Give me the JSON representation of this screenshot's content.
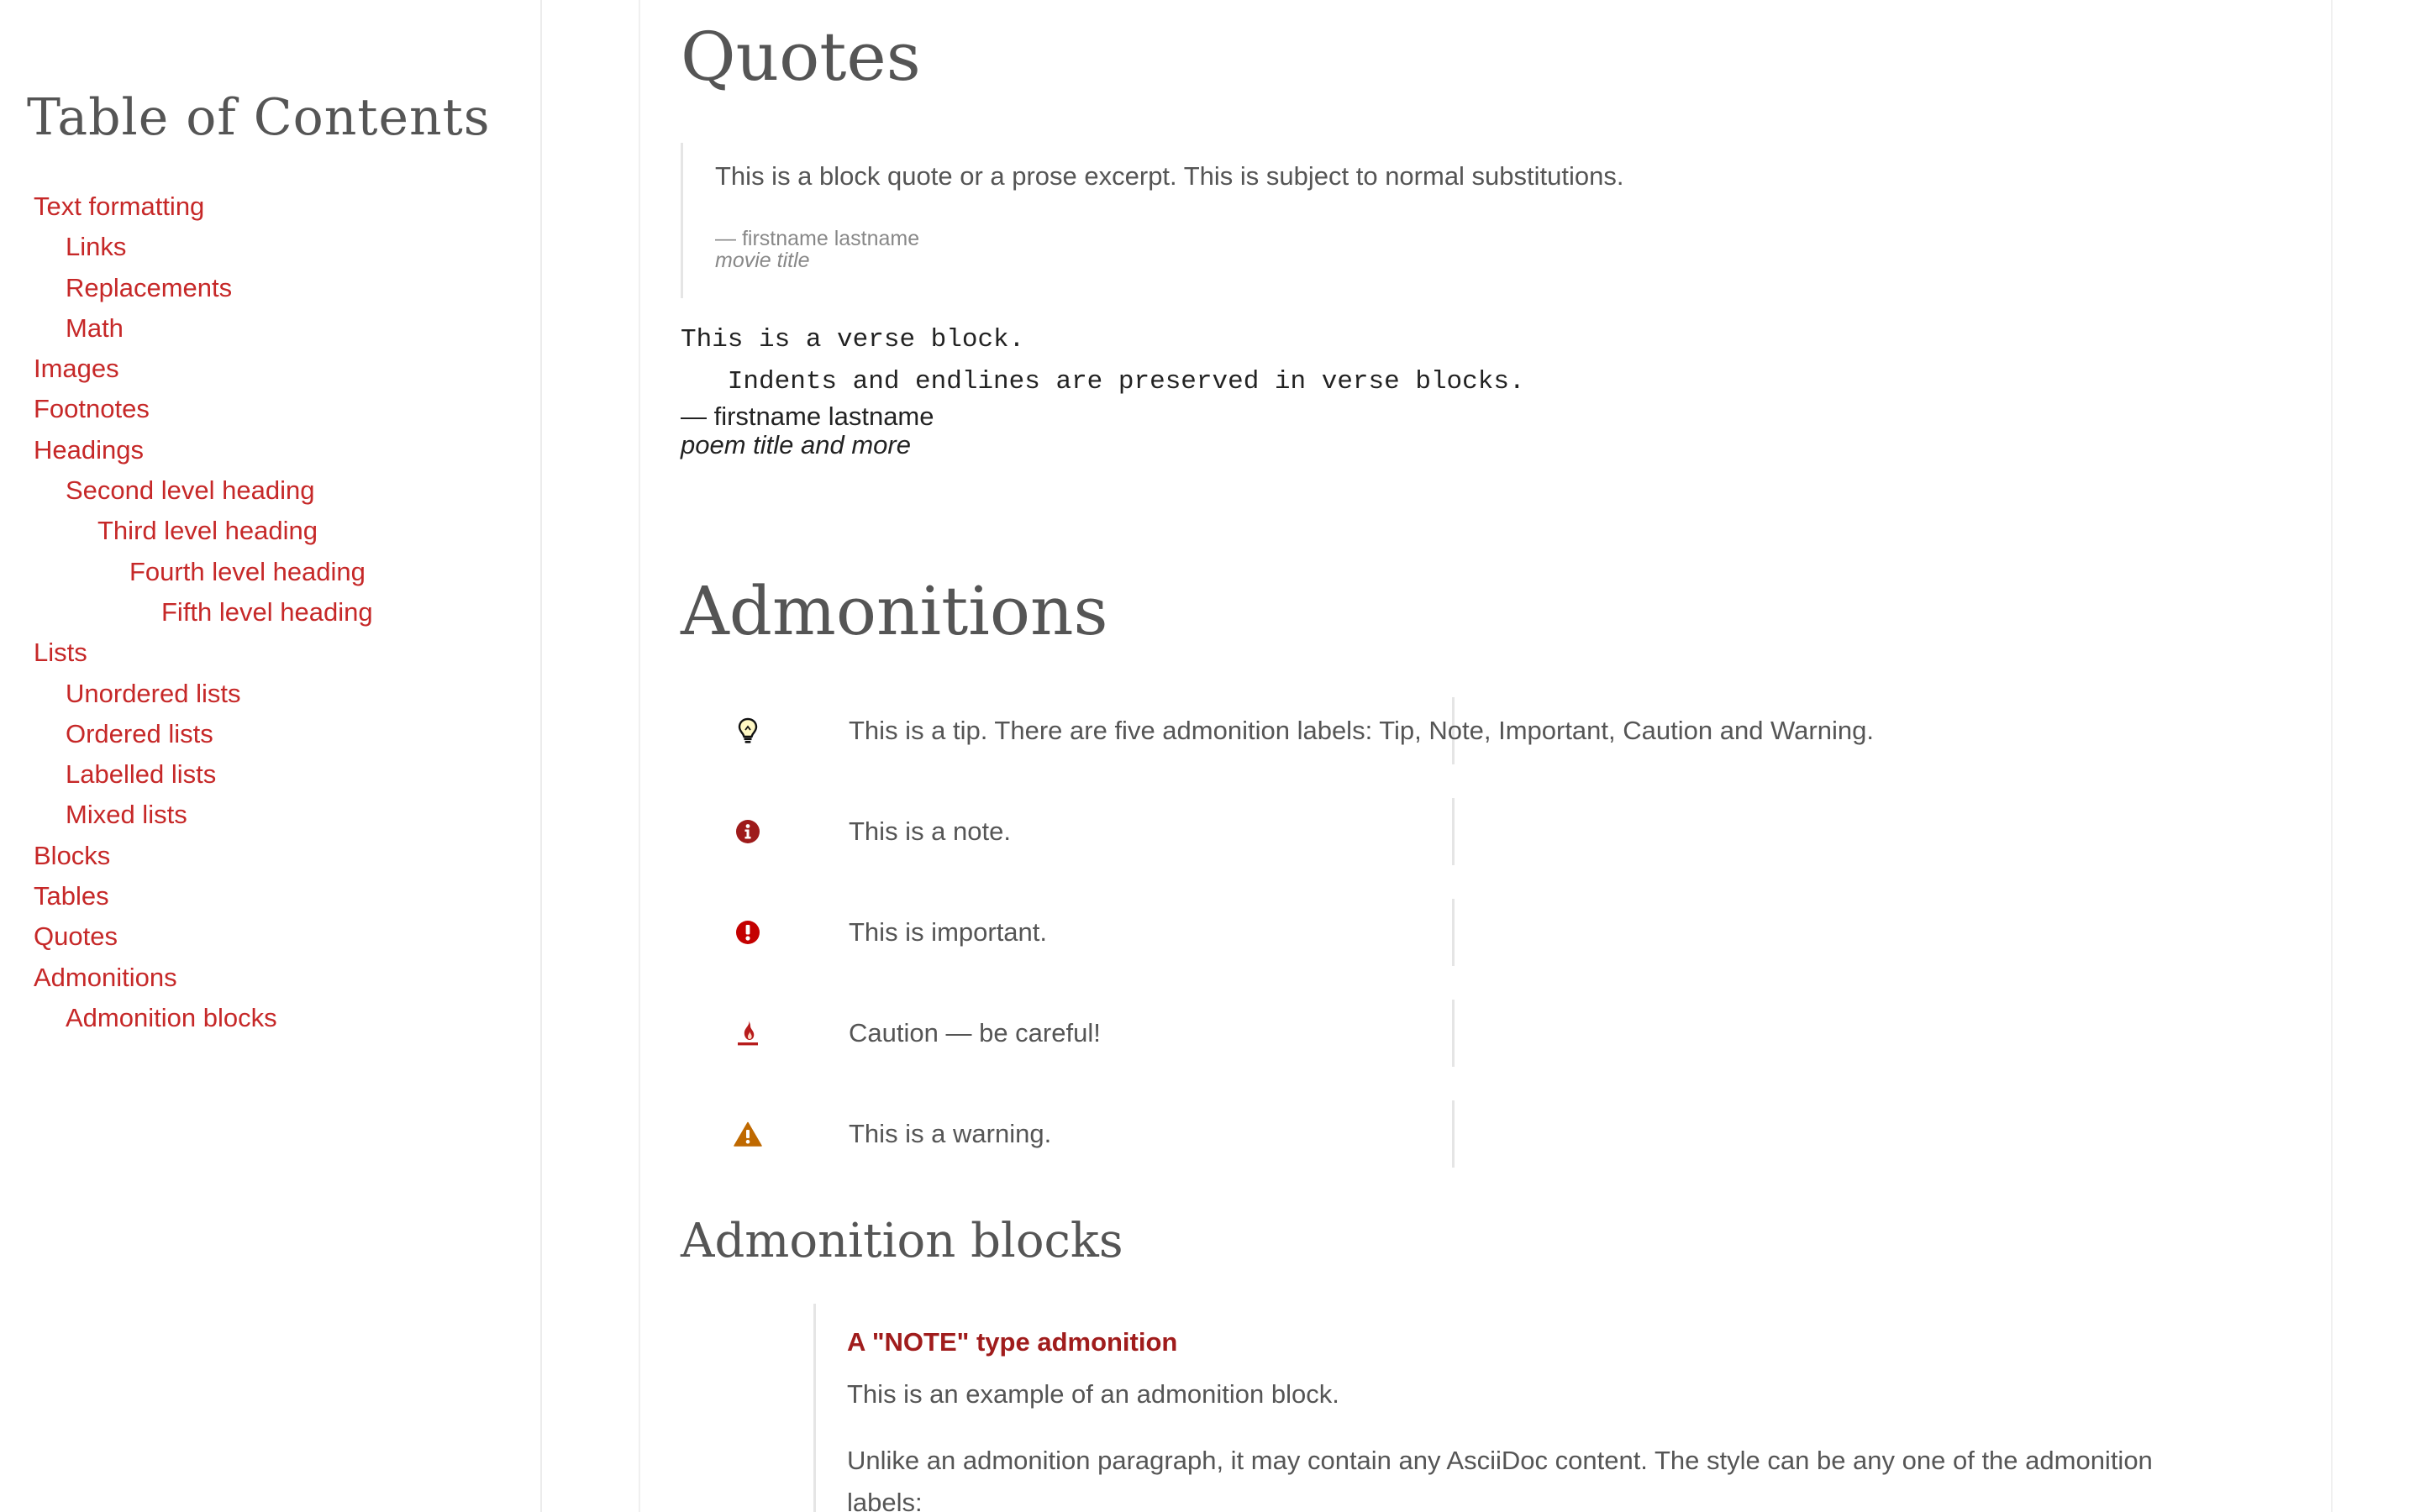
{
  "toc": {
    "title": "Table of Contents",
    "items": [
      {
        "label": "Text formatting"
      },
      {
        "label": "Links"
      },
      {
        "label": "Replacements"
      },
      {
        "label": "Math"
      },
      {
        "label": "Images"
      },
      {
        "label": "Footnotes"
      },
      {
        "label": "Headings"
      },
      {
        "label": "Second level heading"
      },
      {
        "label": "Third level heading"
      },
      {
        "label": "Fourth level heading"
      },
      {
        "label": "Fifth level heading"
      },
      {
        "label": "Lists"
      },
      {
        "label": "Unordered lists"
      },
      {
        "label": "Ordered lists"
      },
      {
        "label": "Labelled lists"
      },
      {
        "label": "Mixed lists"
      },
      {
        "label": "Blocks"
      },
      {
        "label": "Tables"
      },
      {
        "label": "Quotes"
      },
      {
        "label": "Admonitions"
      },
      {
        "label": "Admonition blocks"
      }
    ]
  },
  "quotes": {
    "title": "Quotes",
    "blockquote": {
      "text": "This is a block quote or a prose excerpt. This is subject to normal substitutions.",
      "author": "— firstname lastname",
      "cite": "movie title"
    },
    "verse": {
      "line1": "This is a verse block.",
      "line2": "   Indents and endlines are preserved in verse blocks.",
      "author": "— firstname lastname",
      "cite": "poem title and more"
    }
  },
  "admonitions": {
    "title": "Admonitions",
    "items": [
      {
        "type": "tip",
        "icon": "lightbulb-icon",
        "color": "#111111",
        "text": "This is a tip. There are five admonition labels: Tip, Note, Important, Caution and Warning."
      },
      {
        "type": "note",
        "icon": "info-circle-icon",
        "color": "#9e1b1b",
        "text": "This is a note."
      },
      {
        "type": "important",
        "icon": "exclamation-circle-icon",
        "color": "#c40000",
        "text": "This is important."
      },
      {
        "type": "caution",
        "icon": "fire-icon",
        "color": "#b71c1c",
        "text": "Caution — be careful!"
      },
      {
        "type": "warning",
        "icon": "warning-triangle-icon",
        "color": "#bf6900",
        "text": "This is a warning."
      }
    ]
  },
  "admonition_blocks": {
    "title": "Admonition blocks",
    "block": {
      "heading": "A \"NOTE\" type admonition",
      "p1": "This is an example of an admonition block.",
      "p2": "Unlike an admonition paragraph, it may contain any AsciiDoc content. The style can be any one of the admonition labels:"
    }
  },
  "colors": {
    "link": "#c62828",
    "text": "#555555",
    "rule": "#e5e5e5"
  }
}
